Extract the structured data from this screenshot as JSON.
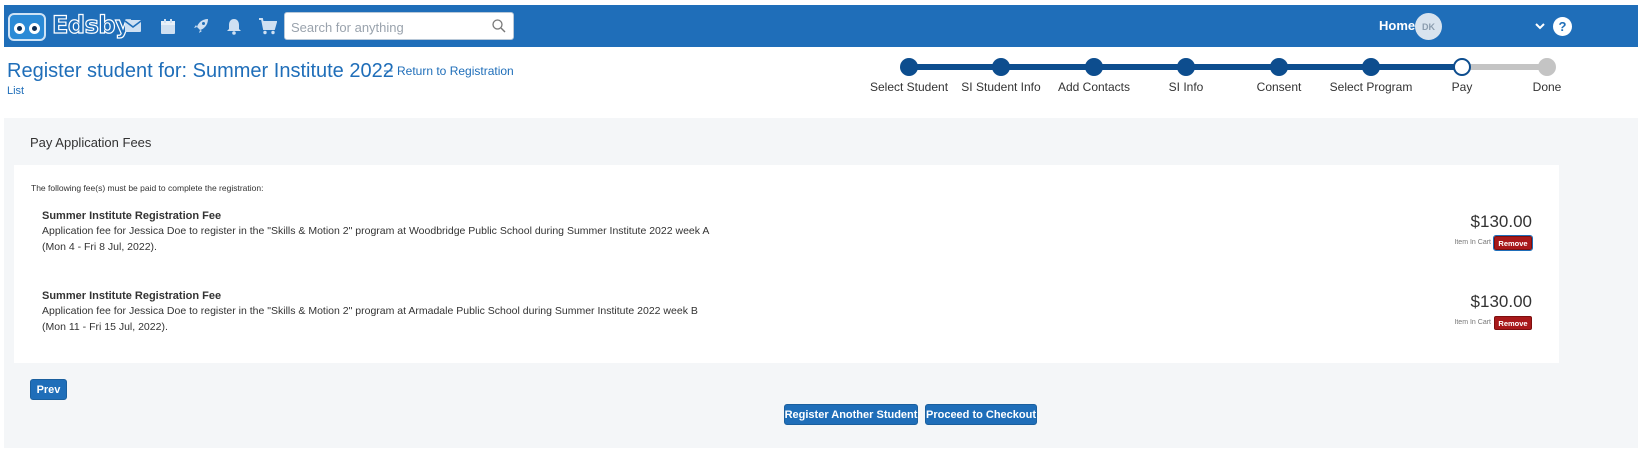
{
  "app": {
    "logo_text": "Edsby",
    "search_placeholder": "Search for anything",
    "home_label": "Home",
    "avatar_initials": "DK",
    "help_label": "?"
  },
  "header": {
    "title": "Register student for: Summer Institute 2022",
    "dash": "–",
    "return_link_part1": "Return to Registration",
    "return_link_part2": "List"
  },
  "steps": [
    {
      "label": "Select Student",
      "state": "done"
    },
    {
      "label": "SI Student Info",
      "state": "done"
    },
    {
      "label": "Add Contacts",
      "state": "done"
    },
    {
      "label": "SI Info",
      "state": "done"
    },
    {
      "label": "Consent",
      "state": "done"
    },
    {
      "label": "Select Program",
      "state": "done"
    },
    {
      "label": "Pay",
      "state": "current"
    },
    {
      "label": "Done",
      "state": "future"
    }
  ],
  "section": {
    "title": "Pay Application Fees",
    "intro": "The following fee(s) must be paid to complete the registration:"
  },
  "fees": [
    {
      "title": "Summer Institute Registration Fee",
      "desc_line1": "Application fee for Jessica Doe to register in the \"Skills & Motion 2\" program at Woodbridge Public School during Summer Institute 2022 week A",
      "desc_line2": "(Mon 4 - Fri 8 Jul, 2022).",
      "price": "$130.00",
      "status": "Item In Cart",
      "remove_label": "Remove"
    },
    {
      "title": "Summer Institute Registration Fee",
      "desc_line1": "Application fee for Jessica Doe to register in the \"Skills & Motion 2\" program at Armadale Public School during Summer Institute 2022 week B",
      "desc_line2": "(Mon 11 - Fri 15 Jul, 2022).",
      "price": "$130.00",
      "status": "Item In Cart",
      "remove_label": "Remove"
    }
  ],
  "buttons": {
    "prev": "Prev",
    "register_another": "Register Another Student",
    "checkout": "Proceed to Checkout"
  },
  "colors": {
    "brand": "#1f6eb9",
    "step_done": "#0d4d8e",
    "remove": "#a8191a"
  }
}
